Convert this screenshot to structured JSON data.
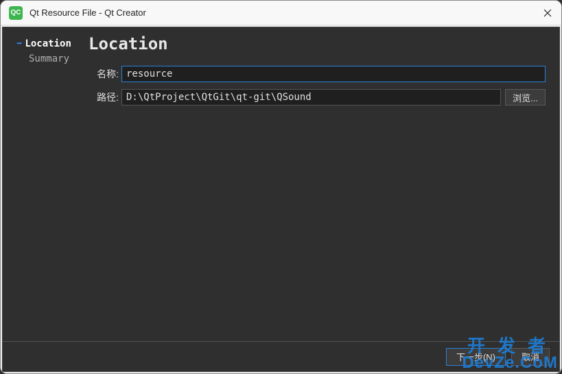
{
  "titlebar": {
    "icon_text": "QC",
    "title": "Qt Resource File - Qt Creator"
  },
  "sidebar": {
    "items": [
      {
        "label": "Location",
        "active": true
      },
      {
        "label": "Summary",
        "active": false
      }
    ]
  },
  "page": {
    "heading": "Location",
    "name_label": "名称:",
    "name_value": "resource",
    "path_label": "路径:",
    "path_value": "D:\\QtProject\\QtGit\\qt-git\\QSound",
    "browse_label": "浏览..."
  },
  "footer": {
    "next_label": "下一步(N)",
    "cancel_label": "取消"
  },
  "watermark": {
    "cn": "开发者",
    "en": "DevZe.CoM"
  }
}
